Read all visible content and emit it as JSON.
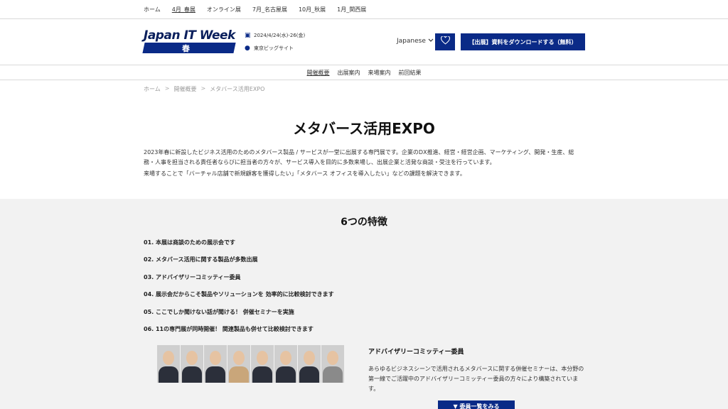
{
  "topnav": {
    "items": [
      {
        "label": "ホーム"
      },
      {
        "label": "4月_春展"
      },
      {
        "label": "オンライン展"
      },
      {
        "label": "7月_名古屋展"
      },
      {
        "label": "10月_秋展"
      },
      {
        "label": "1月_関西展"
      }
    ]
  },
  "header": {
    "logo_text": "Japan IT Week",
    "logo_season": "春",
    "date": "2024/4/24(水)-26(金)",
    "venue": "東京ビッグサイト",
    "language": "Japanese",
    "download_button": "【出展】資料をダウンロードする（無料）"
  },
  "subnav": {
    "items": [
      {
        "label": "開催概要"
      },
      {
        "label": "出展案内"
      },
      {
        "label": "来場案内"
      },
      {
        "label": "前回結果"
      }
    ]
  },
  "breadcrumb": {
    "home": "ホーム",
    "section": "開催概要",
    "current": "メタバース活用EXPO",
    "sep": ">"
  },
  "main": {
    "title": "メタバース活用EXPO",
    "intro1": "2023年春に新設したビジネス活用のためのメタバース製品 / サービスが一堂に出展する専門展です。企業のDX推進、経営・経営企画、マーケティング、開発・生産、総務・人事を担当される責任者ならびに担当者の方々が、サービス導入を目的に多数来場し、出展企業と活発な商談・受注を行っています。",
    "intro2": "来場することで「バーチャル店舗で新規顧客を獲得したい」「メタバース オフィスを導入したい」などの課題を解決できます。"
  },
  "features": {
    "title": "6つの特徴",
    "items": [
      "01. 本展は商談のための展示会です",
      "02. メタバース活用に関する製品が多数出展",
      "03. アドバイザリーコミッティー委員",
      "04. 展示会だからこそ製品やソリューションを 効率的に比較検討できます",
      "05. ここでしか聞けない話が聞ける！ 併催セミナーを実施",
      "06. 11の専門展が同時開催！ 関連製品も併せて比較検討できます"
    ]
  },
  "committee": {
    "title": "アドバイザリーコミッティー委員",
    "text": "あらゆるビジネスシーンで活用されるメタバースに関する併催セミナーは、本分野の第一線でご活躍中のアドバイザリーコミッティー委員の方々により構築されています。",
    "more_button": "▼ 委員一覧をみる"
  },
  "colors": {
    "brand": "#0a2a87",
    "section_bg": "#f2f2f2"
  }
}
